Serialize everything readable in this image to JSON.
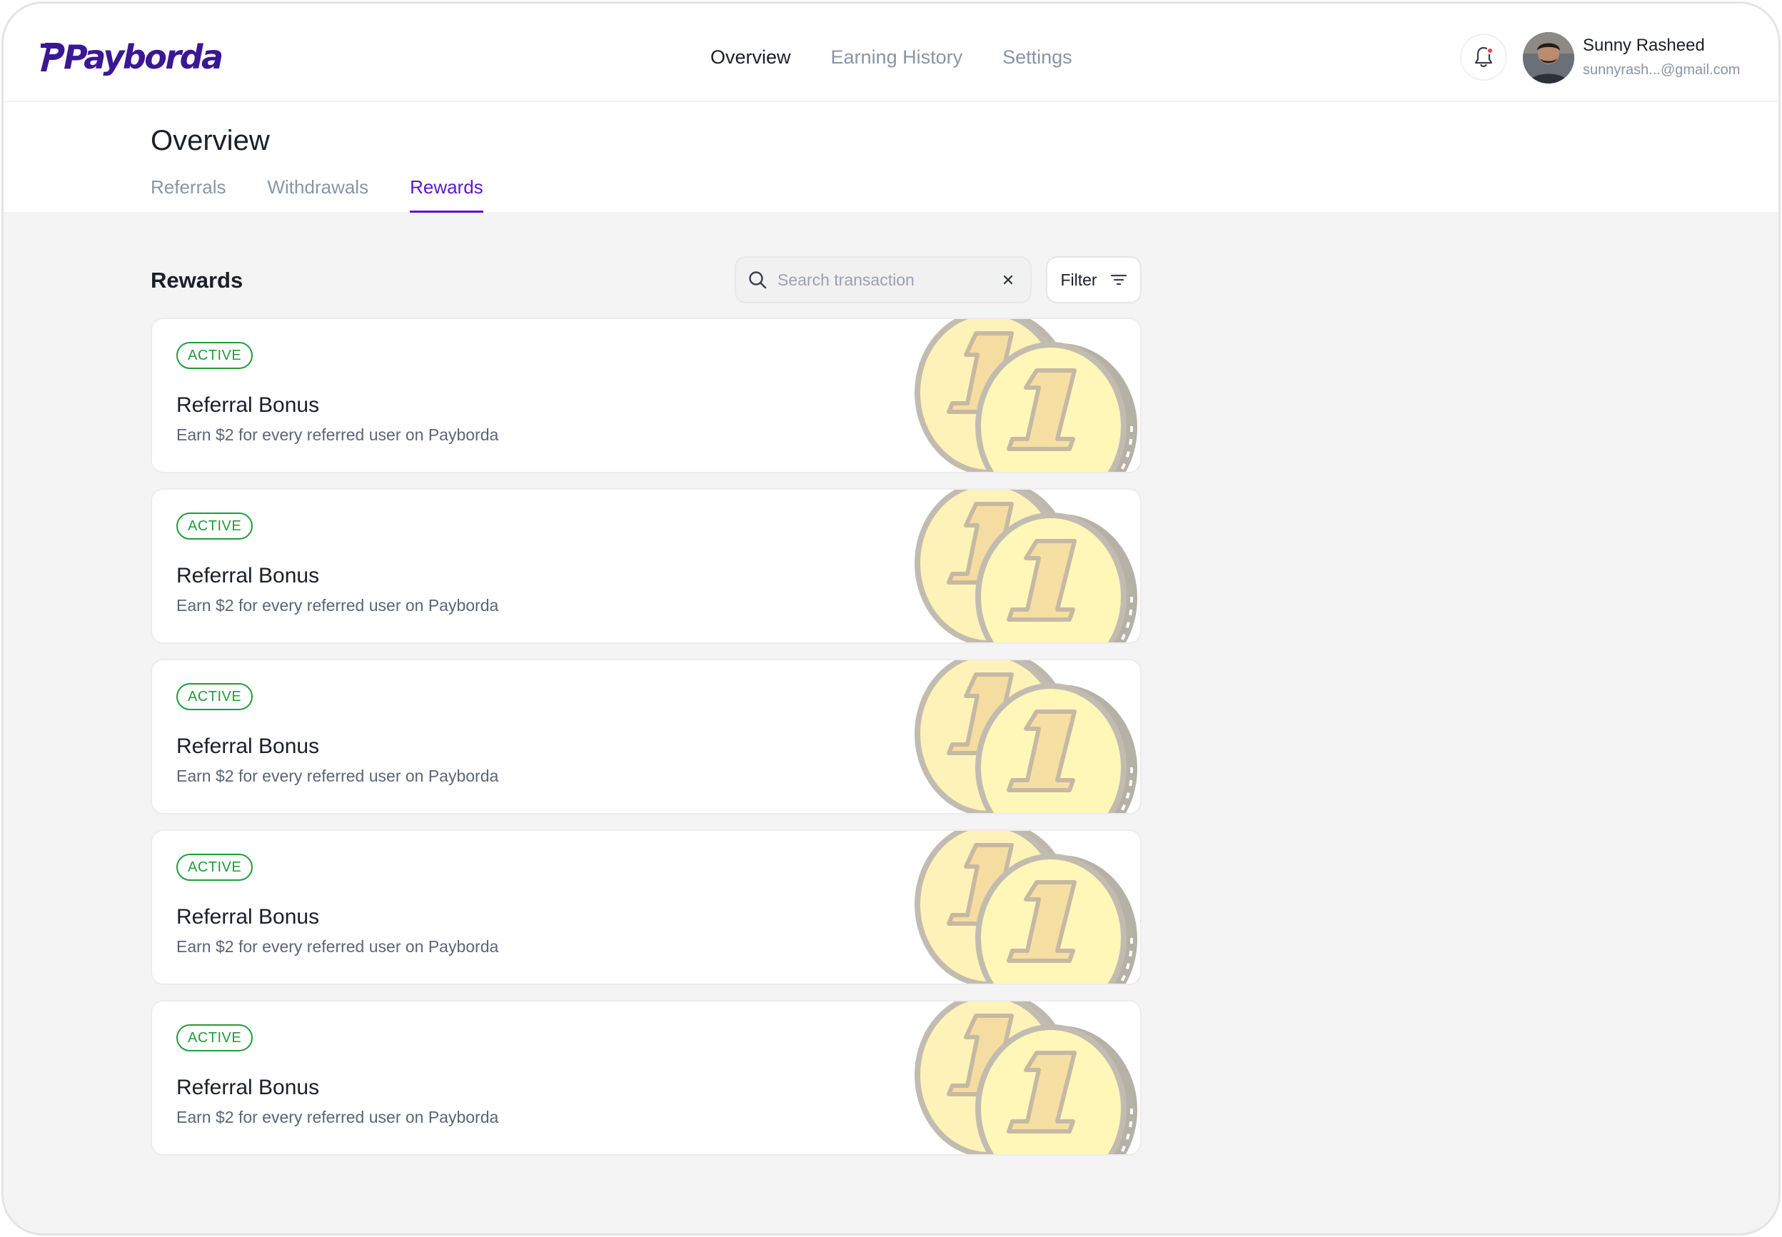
{
  "brand": {
    "name": "Payborda",
    "color": "#3b1793"
  },
  "nav": {
    "items": [
      {
        "label": "Overview",
        "active": true
      },
      {
        "label": "Earning History",
        "active": false
      },
      {
        "label": "Settings",
        "active": false
      }
    ]
  },
  "user": {
    "name": "Sunny Rasheed",
    "email": "sunnyrash...@gmail.com",
    "notification_icon": "bell-icon",
    "has_unread": true
  },
  "page": {
    "title": "Overview",
    "tabs": [
      {
        "label": "Referrals",
        "active": false
      },
      {
        "label": "Withdrawals",
        "active": false
      },
      {
        "label": "Rewards",
        "active": true
      }
    ]
  },
  "rewards": {
    "title": "Rewards",
    "search": {
      "placeholder": "Search transaction",
      "value": ""
    },
    "filter_label": "Filter",
    "cards": [
      {
        "status": "ACTIVE",
        "title": "Referral Bonus",
        "description": "Earn $2 for every referred user on Payborda"
      },
      {
        "status": "ACTIVE",
        "title": "Referral Bonus",
        "description": "Earn $2 for every referred user on Payborda"
      },
      {
        "status": "ACTIVE",
        "title": "Referral Bonus",
        "description": "Earn $2 for every referred user on Payborda"
      },
      {
        "status": "ACTIVE",
        "title": "Referral Bonus",
        "description": "Earn $2 for every referred user on Payborda"
      },
      {
        "status": "ACTIVE",
        "title": "Referral Bonus",
        "description": "Earn $2 for every referred user on Payborda"
      }
    ]
  },
  "colors": {
    "accent": "#5b16d6",
    "active_status": "#1f9d3a",
    "background": "#f4f4f5"
  }
}
